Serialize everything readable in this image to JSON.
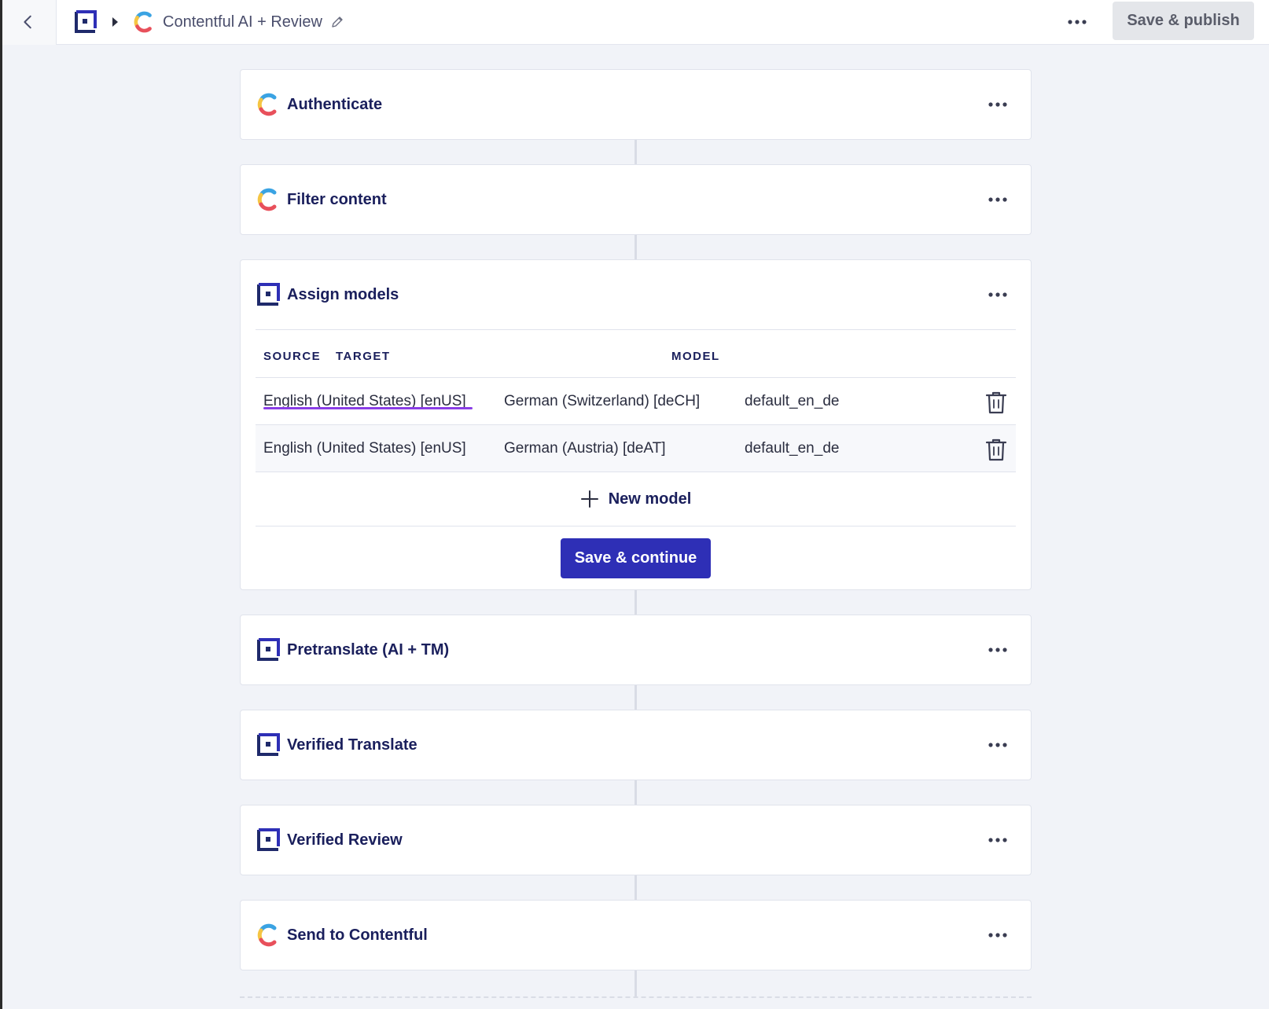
{
  "header": {
    "title": "Contentful AI + Review",
    "publish_label": "Save & publish"
  },
  "steps": [
    {
      "label": "Authenticate",
      "icon": "contentful-icon"
    },
    {
      "label": "Filter content",
      "icon": "contentful-icon"
    },
    {
      "label": "Assign models",
      "icon": "lokalise-icon"
    },
    {
      "label": "Pretranslate (AI + TM)",
      "icon": "lokalise-icon"
    },
    {
      "label": "Verified Translate",
      "icon": "lokalise-icon"
    },
    {
      "label": "Verified Review",
      "icon": "lokalise-icon"
    },
    {
      "label": "Send to Contentful",
      "icon": "contentful-icon"
    }
  ],
  "assign_models": {
    "columns": {
      "source": "SOURCE",
      "target": "TARGET",
      "model": "MODEL"
    },
    "rows": [
      {
        "source": "English (United States) [enUS]",
        "target": "German (Switzerland) [deCH]",
        "model": "default_en_de"
      },
      {
        "source": "English (United States) [enUS]",
        "target": "German (Austria) [deAT]",
        "model": "default_en_de"
      }
    ],
    "new_model_label": "New model",
    "save_continue_label": "Save & continue"
  },
  "colors": {
    "accent": "#2e2fb6",
    "text": "#1a1f5c",
    "underline": "#8a3ee6"
  }
}
